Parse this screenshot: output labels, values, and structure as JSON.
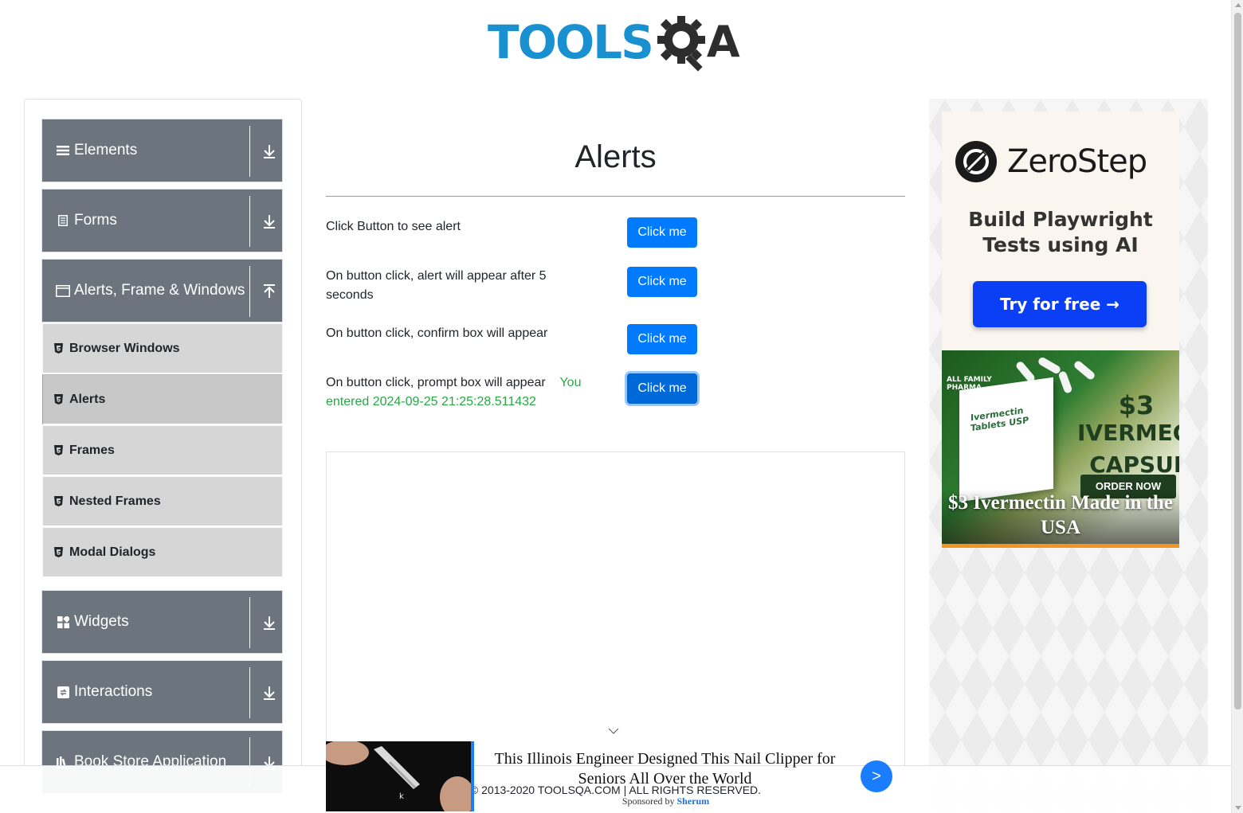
{
  "header": {
    "logo_text_left": "TOOLS",
    "logo_text_right": "A",
    "logo_alt": "TOOLSQA"
  },
  "sidebar": {
    "groups": [
      {
        "label": "Elements",
        "icon": "hamburger-icon",
        "expanded": false
      },
      {
        "label": "Forms",
        "icon": "document-icon",
        "expanded": false
      },
      {
        "label": "Alerts, Frame & Windows",
        "icon": "window-icon",
        "expanded": true
      },
      {
        "label": "Widgets",
        "icon": "widgets-icon",
        "expanded": false
      },
      {
        "label": "Interactions",
        "icon": "interactions-icon",
        "expanded": false
      },
      {
        "label": "Book Store Application",
        "icon": "bookstore-icon",
        "expanded": false
      }
    ],
    "items": [
      {
        "label": "Browser Windows",
        "active": false
      },
      {
        "label": "Alerts",
        "active": true
      },
      {
        "label": "Frames",
        "active": false
      },
      {
        "label": "Nested Frames",
        "active": false
      },
      {
        "label": "Modal Dialogs",
        "active": false
      }
    ]
  },
  "main": {
    "title": "Alerts",
    "rows": [
      {
        "text": "Click Button to see alert",
        "button": "Click me"
      },
      {
        "text": "On button click, alert will appear after 5 seconds",
        "button": "Click me"
      },
      {
        "text": "On button click, confirm box will appear",
        "button": "Click me"
      },
      {
        "text": "On button click, prompt box will appear",
        "result": "You entered 2024-09-25 21:25:28.511432",
        "button": "Click me"
      }
    ]
  },
  "ads": {
    "zerostep": {
      "brand": "ZeroStep",
      "tagline_1": "Build Playwright",
      "tagline_2": "Tests using AI",
      "cta": "Try for free →"
    },
    "ivermectin": {
      "pharma_1": "ALL FAMILY",
      "pharma_2": "PHARMA",
      "package_1": "Ivermectin",
      "package_2": "Tablets USP",
      "price": "$3",
      "product_1": "IVERMECTIN",
      "product_2": "CAPSULES",
      "order": "ORDER NOW",
      "headline": "$3 Ivermectin Made in the USA"
    },
    "native": {
      "title": "This Illinois Engineer Designed This Nail Clipper for Seniors All Over the World",
      "next": ">"
    }
  },
  "footer": {
    "copyright": "© 2013-2020 TOOLSQA.COM | ALL RIGHTS RESERVED.",
    "sponsored_prefix": "Sponsored by",
    "sponsor": "Sherum"
  },
  "colors": {
    "primary": "#007bff",
    "sidebar": "#6c757d",
    "success": "#28a745",
    "brand": "#1990cf"
  }
}
